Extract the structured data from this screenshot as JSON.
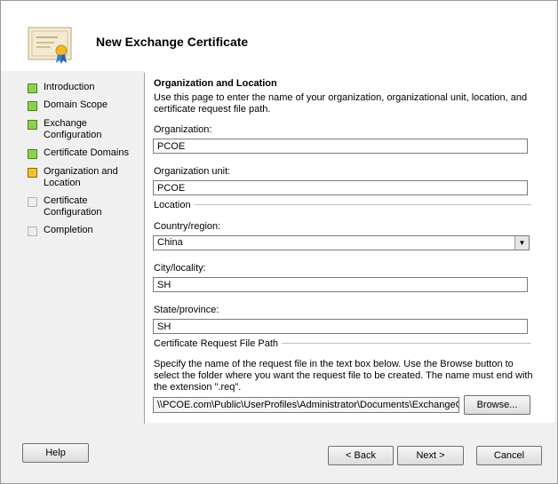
{
  "header": {
    "title": "New Exchange Certificate",
    "icon": "certificate-icon"
  },
  "nav": {
    "items": [
      {
        "label": "Introduction",
        "state": "done"
      },
      {
        "label": "Domain Scope",
        "state": "done"
      },
      {
        "label": "Exchange Configuration",
        "line1": "Exchange",
        "line2": "Configuration",
        "state": "done"
      },
      {
        "label": "Certificate Domains",
        "state": "done"
      },
      {
        "label": "Organization and Location",
        "line1": "Organization and",
        "line2": "Location",
        "state": "current"
      },
      {
        "label": "Certificate Configuration",
        "line1": "Certificate",
        "line2": "Configuration",
        "state": "todo"
      },
      {
        "label": "Completion",
        "state": "todo"
      }
    ]
  },
  "page": {
    "section_title": "Organization and Location",
    "description": "Use this page to enter the name of your organization, organizational unit, location, and certificate request file path.",
    "organization": {
      "label": "Organization:",
      "value": "PCOE"
    },
    "organization_unit": {
      "label": "Organization unit:",
      "value": "PCOE"
    },
    "location_group": "Location",
    "country": {
      "label": "Country/region:",
      "value": "China"
    },
    "city": {
      "label": "City/locality:",
      "value": "SH"
    },
    "state": {
      "label": "State/province:",
      "value": "SH"
    },
    "request_group": "Certificate Request File Path",
    "request_desc": "Specify the name of the request file in the text box below. Use the Browse button to select the folder where you want the request file to be created. The name must end with the extension \".req\".",
    "request_path": "\\\\PCOE.com\\Public\\UserProfiles\\Administrator\\Documents\\ExchangeCe",
    "browse_label": "Browse..."
  },
  "footer": {
    "help_label": "Help",
    "back_label": "< Back",
    "next_label": "Next >",
    "cancel_label": "Cancel"
  }
}
